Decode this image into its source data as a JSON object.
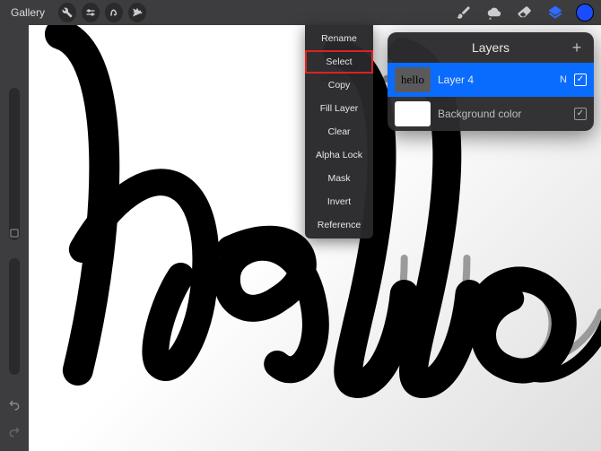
{
  "topbar": {
    "gallery": "Gallery"
  },
  "context_menu": {
    "items": [
      {
        "label": "Rename",
        "highlight": false
      },
      {
        "label": "Select",
        "highlight": true
      },
      {
        "label": "Copy",
        "highlight": false
      },
      {
        "label": "Fill Layer",
        "highlight": false
      },
      {
        "label": "Clear",
        "highlight": false
      },
      {
        "label": "Alpha Lock",
        "highlight": false
      },
      {
        "label": "Mask",
        "highlight": false
      },
      {
        "label": "Invert",
        "highlight": false
      },
      {
        "label": "Reference",
        "highlight": false
      }
    ]
  },
  "layers": {
    "title": "Layers",
    "items": [
      {
        "name": "Layer 4",
        "blend": "N",
        "visible": true,
        "selected": true,
        "thumb_text": "hello"
      },
      {
        "name": "Background color",
        "blend": "",
        "visible": true,
        "selected": false,
        "thumb_text": ""
      }
    ]
  },
  "canvas": {
    "artwork_text": "hello"
  },
  "color_swatch": "#1b4dff"
}
